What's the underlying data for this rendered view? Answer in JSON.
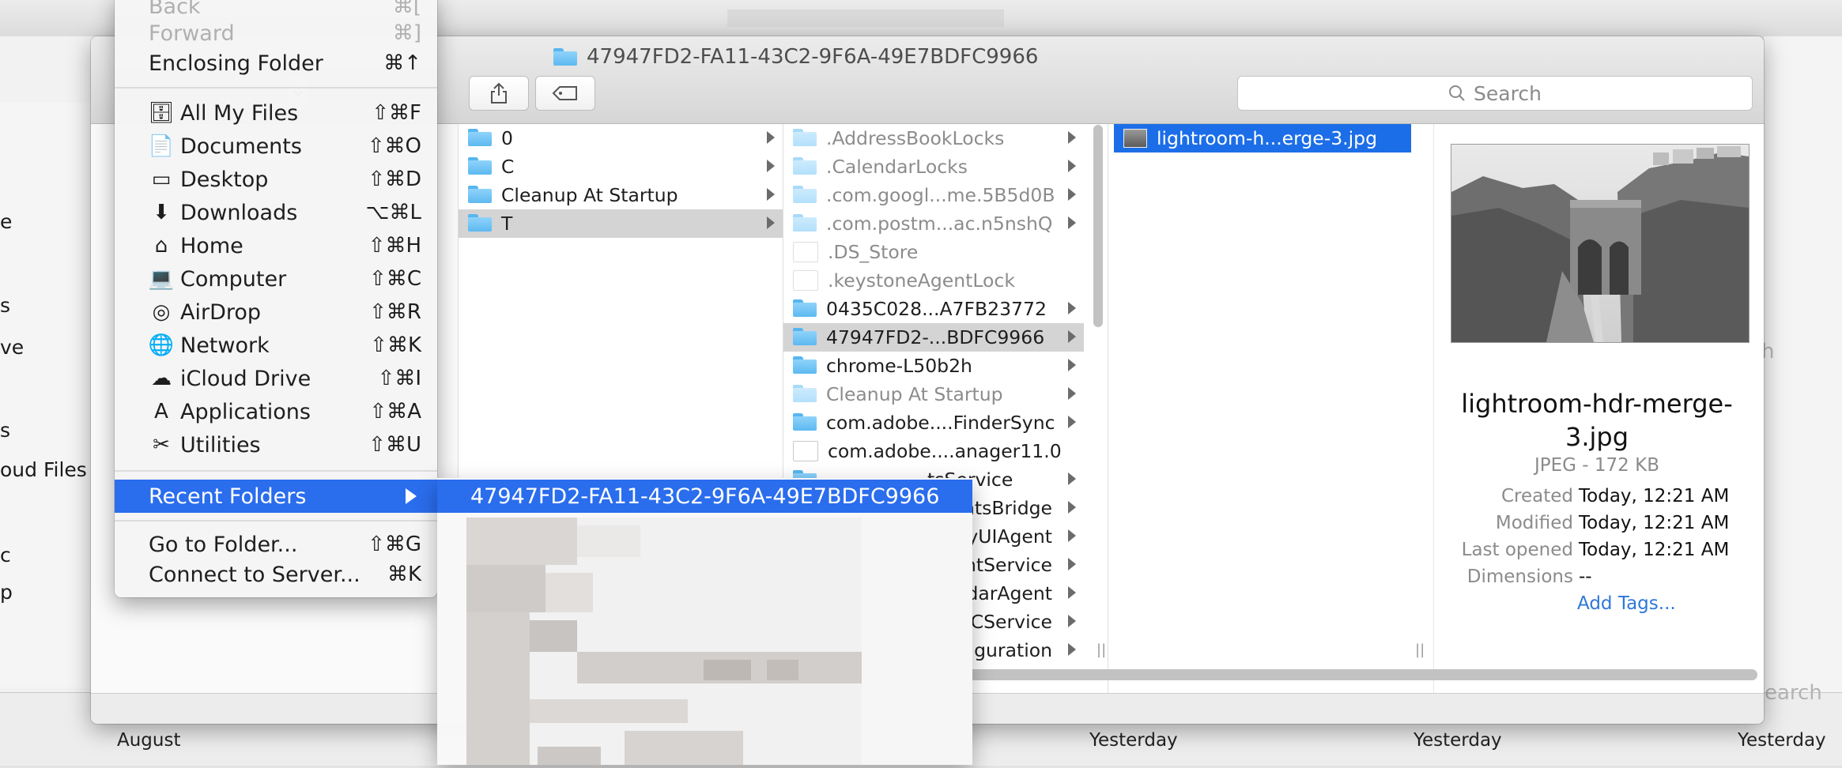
{
  "window_title": "47947FD2-FA11-43C2-9F6A-49E7BDFC9966",
  "search": {
    "placeholder": "Search"
  },
  "go_menu": {
    "back": {
      "label": "Back",
      "shortcut": "⌘["
    },
    "forward": {
      "label": "Forward",
      "shortcut": "⌘]"
    },
    "enclosing": {
      "label": "Enclosing Folder",
      "shortcut": "⌘↑"
    },
    "places": [
      {
        "label": "All My Files",
        "shortcut": "⇧⌘F",
        "icon": "all-my-files-icon"
      },
      {
        "label": "Documents",
        "shortcut": "⇧⌘O",
        "icon": "documents-icon"
      },
      {
        "label": "Desktop",
        "shortcut": "⇧⌘D",
        "icon": "desktop-icon"
      },
      {
        "label": "Downloads",
        "shortcut": "⌥⌘L",
        "icon": "downloads-icon"
      },
      {
        "label": "Home",
        "shortcut": "⇧⌘H",
        "icon": "home-icon"
      },
      {
        "label": "Computer",
        "shortcut": "⇧⌘C",
        "icon": "computer-icon"
      },
      {
        "label": "AirDrop",
        "shortcut": "⇧⌘R",
        "icon": "airdrop-icon"
      },
      {
        "label": "Network",
        "shortcut": "⇧⌘K",
        "icon": "network-icon"
      },
      {
        "label": "iCloud Drive",
        "shortcut": "⇧⌘I",
        "icon": "icloud-icon"
      },
      {
        "label": "Applications",
        "shortcut": "⇧⌘A",
        "icon": "applications-icon"
      },
      {
        "label": "Utilities",
        "shortcut": "⇧⌘U",
        "icon": "utilities-icon"
      }
    ],
    "recent_folders": {
      "label": "Recent Folders"
    },
    "goto": {
      "label": "Go to Folder...",
      "shortcut": "⇧⌘G"
    },
    "connect": {
      "label": "Connect to Server...",
      "shortcut": "⌘K"
    }
  },
  "recent_submenu": {
    "first_item": "47947FD2-FA11-43C2-9F6A-49E7BDFC9966"
  },
  "col1": [
    {
      "name": "0"
    },
    {
      "name": "C"
    },
    {
      "name": "Cleanup At Startup"
    },
    {
      "name": "T"
    }
  ],
  "col2": [
    {
      "name": ".AddressBookLocks"
    },
    {
      "name": ".CalendarLocks"
    },
    {
      "name": ".com.googl...me.5B5d0B"
    },
    {
      "name": ".com.postm...ac.n5nshQ"
    },
    {
      "name": ".DS_Store"
    },
    {
      "name": ".keystoneAgentLock"
    },
    {
      "name": "0435C028...A7FB23772"
    },
    {
      "name": "47947FD2-...BDFC9966"
    },
    {
      "name": "chrome-L50b2h"
    },
    {
      "name": "Cleanup At Startup"
    },
    {
      "name": "com.adobe....FinderSync"
    },
    {
      "name": "com.adobe....anager11.0"
    },
    {
      "name": "tsService"
    },
    {
      "name": "ntsBridge"
    },
    {
      "name": "yUIAgent"
    },
    {
      "name": "ntService"
    },
    {
      "name": "darAgent"
    },
    {
      "name": "CService"
    },
    {
      "name": "iguration"
    }
  ],
  "col3": [
    {
      "name": "lightroom-h...erge-3.jpg"
    }
  ],
  "preview": {
    "name": "lightroom-hdr-merge-3.jpg",
    "kind": "JPEG - 172 KB",
    "created_label": "Created",
    "created": "Today, 12:21 AM",
    "modified_label": "Modified",
    "modified": "Today, 12:21 AM",
    "opened_label": "Last opened",
    "opened": "Today, 12:21 AM",
    "dimensions_label": "Dimensions",
    "dimensions": "--",
    "add_tags": "Add Tags..."
  },
  "background": {
    "left_fragments": [
      "e",
      "s",
      "ve",
      "s",
      "oud Files",
      "c",
      "p"
    ],
    "bottom_dates": [
      "August",
      "Yesterday",
      "Yesterday",
      "Yesterday"
    ],
    "right_fragments": [
      "h",
      "earch"
    ]
  }
}
